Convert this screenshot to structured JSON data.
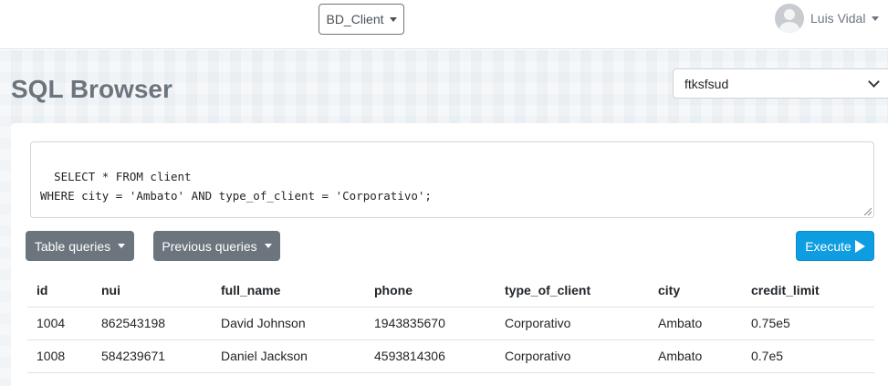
{
  "header": {
    "database_label": "BD_Client",
    "user_name": "Luis Vidal"
  },
  "page": {
    "title": "SQL Browser",
    "connection_value": "ftksfsud"
  },
  "query": {
    "text": "SELECT * FROM client\nWHERE city = 'Ambato' AND type_of_client = 'Corporativo';"
  },
  "toolbar": {
    "table_queries_label": "Table queries",
    "previous_queries_label": "Previous queries",
    "execute_label": "Execute"
  },
  "results": {
    "columns": [
      "id",
      "nui",
      "full_name",
      "phone",
      "type_of_client",
      "city",
      "credit_limit"
    ],
    "rows": [
      [
        "1004",
        "862543198",
        "David Johnson",
        "1943835670",
        "Corporativo",
        "Ambato",
        "0.75e5"
      ],
      [
        "1008",
        "584239671",
        "Daniel Jackson",
        "4593814306",
        "Corporativo",
        "Ambato",
        "0.7e5"
      ]
    ]
  },
  "colors": {
    "execute_button": "#0d9de0",
    "secondary_button": "#6c757d",
    "title": "#6c757d"
  }
}
